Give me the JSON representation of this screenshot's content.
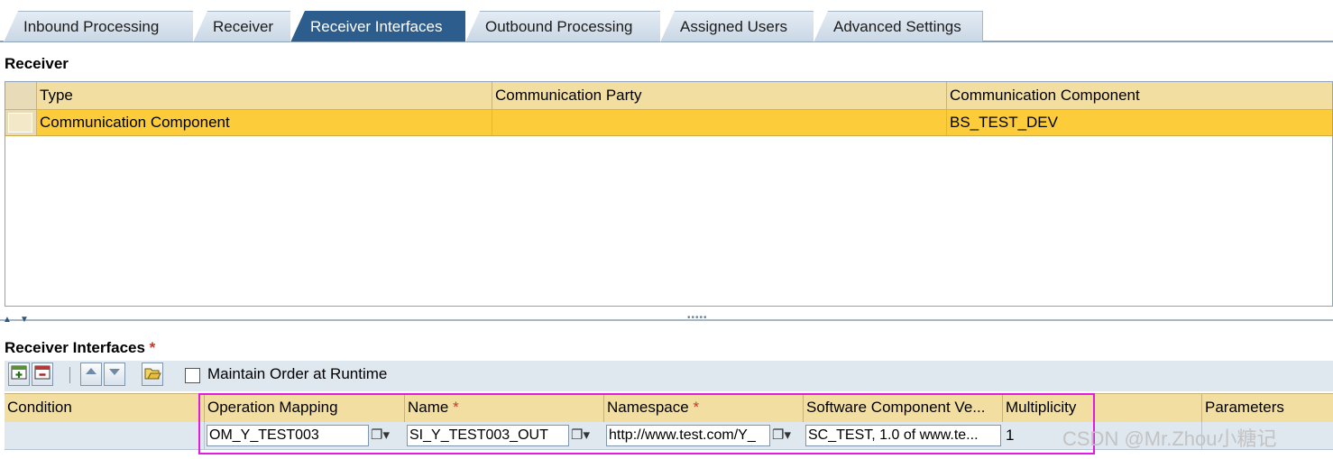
{
  "tabs": [
    {
      "label": "Inbound Processing",
      "active": false
    },
    {
      "label": "Receiver",
      "active": false
    },
    {
      "label": "Receiver Interfaces",
      "active": true
    },
    {
      "label": "Outbound Processing",
      "active": false
    },
    {
      "label": "Assigned Users",
      "active": false
    },
    {
      "label": "Advanced Settings",
      "active": false
    }
  ],
  "receiver": {
    "title": "Receiver",
    "columns": [
      "Type",
      "Communication Party",
      "Communication Component"
    ],
    "rows": [
      {
        "type": "Communication Component",
        "party": "",
        "component": "BS_TEST_DEV"
      }
    ]
  },
  "interfaces": {
    "title": "Receiver Interfaces",
    "required_mark": "*",
    "toolbar": {
      "maintain_order_label": "Maintain Order at Runtime",
      "maintain_order_checked": false
    },
    "columns": {
      "condition": "Condition",
      "operation_mapping": "Operation Mapping",
      "name": "Name",
      "namespace": "Namespace",
      "swcv": "Software Component Ve...",
      "multiplicity": "Multiplicity",
      "parameters": "Parameters"
    },
    "rows": [
      {
        "condition": "",
        "operation_mapping": "OM_Y_TEST003",
        "name": "SI_Y_TEST003_OUT",
        "namespace": "http://www.test.com/Y_",
        "swcv": "SC_TEST, 1.0 of www.te...",
        "multiplicity": "1"
      }
    ]
  },
  "watermark": "CSDN @Mr.Zhou小糖记",
  "colors": {
    "tab_active": "#2d5d8c",
    "header_bg": "#f3dea2",
    "selected_row": "#fccc3a",
    "highlight_frame": "#e21be2"
  }
}
